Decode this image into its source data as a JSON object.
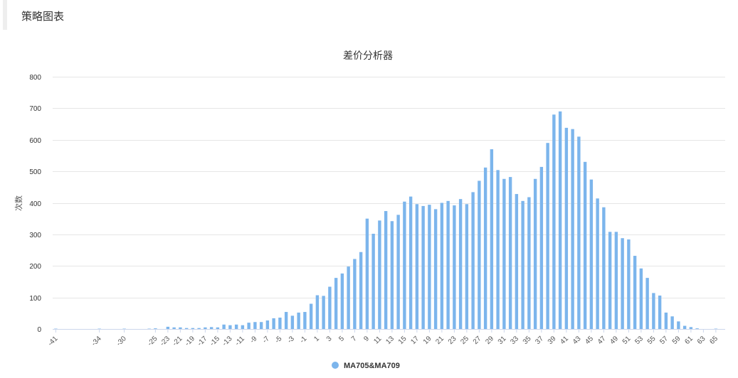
{
  "header": {
    "title": "策略图表"
  },
  "chart_data": {
    "type": "bar",
    "title": "差价分析器",
    "xlabel": "",
    "ylabel": "次数",
    "ylim": [
      0,
      800
    ],
    "yticks": [
      0,
      100,
      200,
      300,
      400,
      500,
      600,
      700,
      800
    ],
    "xticks": [
      -41,
      -34,
      -30,
      -25,
      -23,
      -21,
      -19,
      -17,
      -15,
      -13,
      -11,
      -9,
      -7,
      -5,
      -3,
      -1,
      1,
      3,
      5,
      7,
      9,
      11,
      13,
      15,
      17,
      19,
      21,
      23,
      25,
      27,
      29,
      31,
      33,
      35,
      37,
      39,
      41,
      43,
      45,
      47,
      49,
      51,
      53,
      55,
      57,
      59,
      61,
      63,
      65
    ],
    "grid": true,
    "legend_position": "bottom-center",
    "color": "#7cb5ec",
    "categories": [
      -41,
      -40,
      -39,
      -38,
      -37,
      -36,
      -35,
      -34,
      -33,
      -32,
      -31,
      -30,
      -29,
      -28,
      -27,
      -26,
      -25,
      -24,
      -23,
      -22,
      -21,
      -20,
      -19,
      -18,
      -17,
      -16,
      -15,
      -14,
      -13,
      -12,
      -11,
      -10,
      -9,
      -8,
      -7,
      -6,
      -5,
      -4,
      -3,
      -2,
      -1,
      0,
      1,
      2,
      3,
      4,
      5,
      6,
      7,
      8,
      9,
      10,
      11,
      12,
      13,
      14,
      15,
      16,
      17,
      18,
      19,
      20,
      21,
      22,
      23,
      24,
      25,
      26,
      27,
      28,
      29,
      30,
      31,
      32,
      33,
      34,
      35,
      36,
      37,
      38,
      39,
      40,
      41,
      42,
      43,
      44,
      45,
      46,
      47,
      48,
      49,
      50,
      51,
      52,
      53,
      54,
      55,
      56,
      57,
      58,
      59,
      60,
      61,
      62,
      63,
      64,
      65,
      66
    ],
    "series": [
      {
        "name": "MA705&MA709",
        "values": [
          1,
          0,
          0,
          0,
          0,
          0,
          0,
          1,
          0,
          0,
          0,
          1,
          0,
          0,
          0,
          1,
          2,
          0,
          7,
          5,
          5,
          3,
          3,
          3,
          5,
          6,
          5,
          14,
          12,
          14,
          12,
          20,
          22,
          22,
          27,
          34,
          36,
          54,
          42,
          52,
          54,
          80,
          107,
          105,
          134,
          162,
          176,
          198,
          222,
          244,
          350,
          302,
          344,
          374,
          342,
          362,
          404,
          420,
          396,
          390,
          394,
          380,
          400,
          406,
          392,
          412,
          396,
          434,
          470,
          512,
          570,
          504,
          476,
          482,
          428,
          406,
          418,
          476,
          514,
          590,
          680,
          690,
          638,
          634,
          610,
          530,
          474,
          414,
          386,
          308,
          308,
          288,
          284,
          232,
          192,
          162,
          114,
          106,
          52,
          40,
          24,
          10,
          6,
          2,
          0,
          0,
          1,
          0
        ]
      }
    ]
  }
}
